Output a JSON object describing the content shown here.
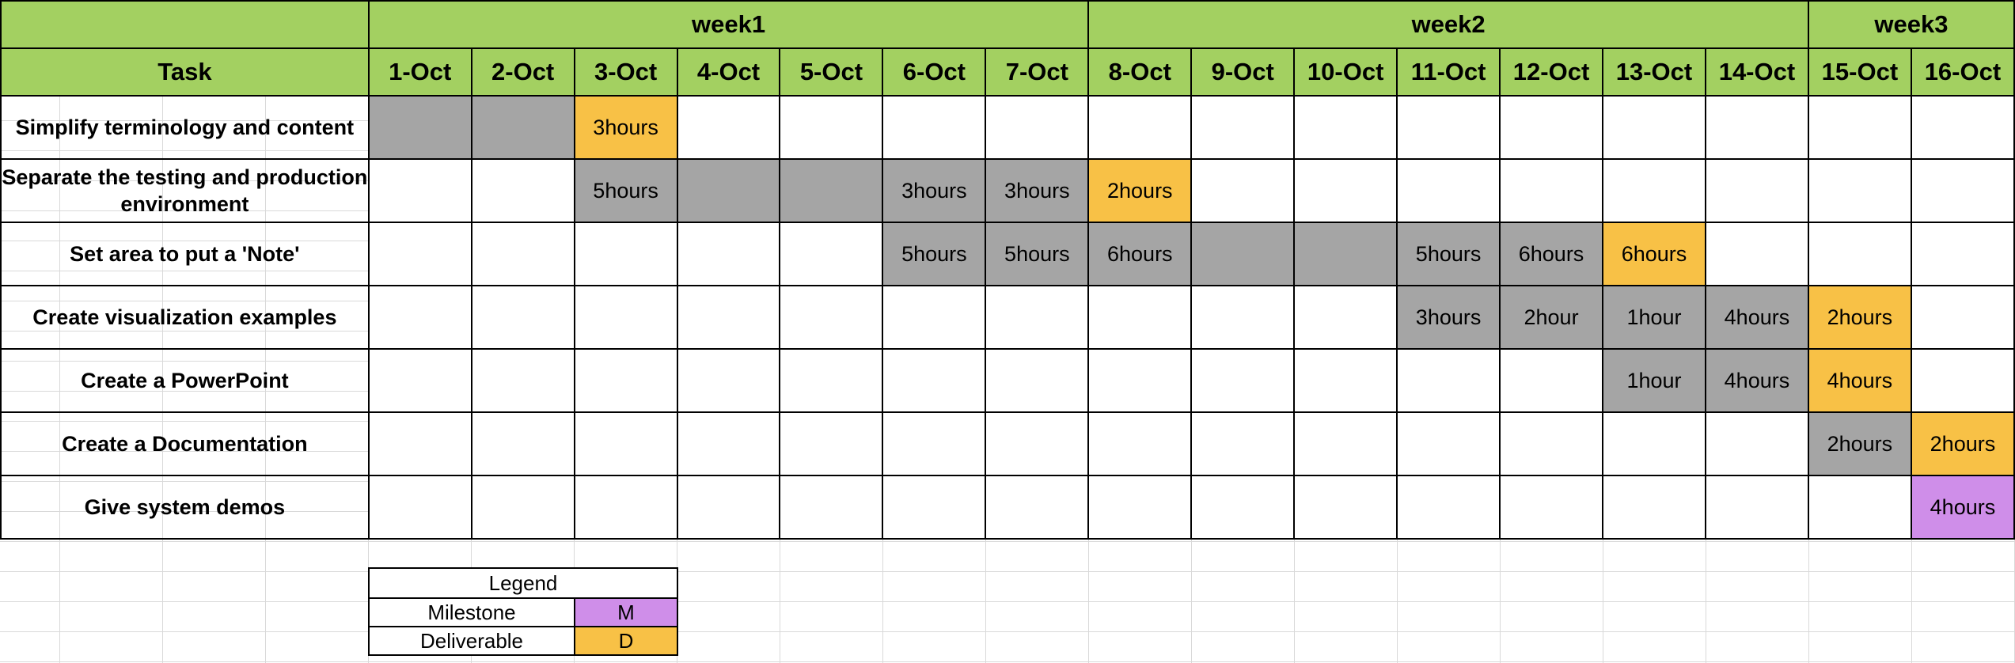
{
  "weeks": [
    {
      "label": "week1",
      "span": 7
    },
    {
      "label": "week2",
      "span": 7
    },
    {
      "label": "week3",
      "span": 2
    }
  ],
  "task_header": "Task",
  "dates": [
    "1-Oct",
    "2-Oct",
    "3-Oct",
    "4-Oct",
    "5-Oct",
    "6-Oct",
    "7-Oct",
    "8-Oct",
    "9-Oct",
    "10-Oct",
    "11-Oct",
    "12-Oct",
    "13-Oct",
    "14-Oct",
    "15-Oct",
    "16-Oct"
  ],
  "tasks": [
    {
      "name": "Simplify terminology and content",
      "cells": [
        {
          "c": "gray",
          "t": ""
        },
        {
          "c": "gray",
          "t": ""
        },
        {
          "c": "yellow",
          "t": "3hours"
        },
        {
          "c": "white",
          "t": ""
        },
        {
          "c": "white",
          "t": ""
        },
        {
          "c": "white",
          "t": ""
        },
        {
          "c": "white",
          "t": ""
        },
        {
          "c": "white",
          "t": ""
        },
        {
          "c": "white",
          "t": ""
        },
        {
          "c": "white",
          "t": ""
        },
        {
          "c": "white",
          "t": ""
        },
        {
          "c": "white",
          "t": ""
        },
        {
          "c": "white",
          "t": ""
        },
        {
          "c": "white",
          "t": ""
        },
        {
          "c": "white",
          "t": ""
        },
        {
          "c": "white",
          "t": ""
        }
      ]
    },
    {
      "name": "Separate the testing and production environment",
      "cells": [
        {
          "c": "white",
          "t": ""
        },
        {
          "c": "white",
          "t": ""
        },
        {
          "c": "gray",
          "t": "5hours"
        },
        {
          "c": "gray",
          "t": ""
        },
        {
          "c": "gray",
          "t": ""
        },
        {
          "c": "gray",
          "t": "3hours"
        },
        {
          "c": "gray",
          "t": "3hours"
        },
        {
          "c": "yellow",
          "t": "2hours"
        },
        {
          "c": "white",
          "t": ""
        },
        {
          "c": "white",
          "t": ""
        },
        {
          "c": "white",
          "t": ""
        },
        {
          "c": "white",
          "t": ""
        },
        {
          "c": "white",
          "t": ""
        },
        {
          "c": "white",
          "t": ""
        },
        {
          "c": "white",
          "t": ""
        },
        {
          "c": "white",
          "t": ""
        }
      ]
    },
    {
      "name": "Set area to put a 'Note'",
      "cells": [
        {
          "c": "white",
          "t": ""
        },
        {
          "c": "white",
          "t": ""
        },
        {
          "c": "white",
          "t": ""
        },
        {
          "c": "white",
          "t": ""
        },
        {
          "c": "white",
          "t": ""
        },
        {
          "c": "gray",
          "t": "5hours"
        },
        {
          "c": "gray",
          "t": "5hours"
        },
        {
          "c": "gray",
          "t": "6hours"
        },
        {
          "c": "gray",
          "t": ""
        },
        {
          "c": "gray",
          "t": ""
        },
        {
          "c": "gray",
          "t": "5hours"
        },
        {
          "c": "gray",
          "t": "6hours"
        },
        {
          "c": "yellow",
          "t": "6hours"
        },
        {
          "c": "white",
          "t": ""
        },
        {
          "c": "white",
          "t": ""
        },
        {
          "c": "white",
          "t": ""
        }
      ]
    },
    {
      "name": "Create visualization examples",
      "cells": [
        {
          "c": "white",
          "t": ""
        },
        {
          "c": "white",
          "t": ""
        },
        {
          "c": "white",
          "t": ""
        },
        {
          "c": "white",
          "t": ""
        },
        {
          "c": "white",
          "t": ""
        },
        {
          "c": "white",
          "t": ""
        },
        {
          "c": "white",
          "t": ""
        },
        {
          "c": "white",
          "t": ""
        },
        {
          "c": "white",
          "t": ""
        },
        {
          "c": "white",
          "t": ""
        },
        {
          "c": "gray",
          "t": "3hours"
        },
        {
          "c": "gray",
          "t": "2hour"
        },
        {
          "c": "gray",
          "t": "1hour"
        },
        {
          "c": "gray",
          "t": "4hours"
        },
        {
          "c": "yellow",
          "t": "2hours"
        },
        {
          "c": "white",
          "t": ""
        }
      ]
    },
    {
      "name": "Create a PowerPoint",
      "cells": [
        {
          "c": "white",
          "t": ""
        },
        {
          "c": "white",
          "t": ""
        },
        {
          "c": "white",
          "t": ""
        },
        {
          "c": "white",
          "t": ""
        },
        {
          "c": "white",
          "t": ""
        },
        {
          "c": "white",
          "t": ""
        },
        {
          "c": "white",
          "t": ""
        },
        {
          "c": "white",
          "t": ""
        },
        {
          "c": "white",
          "t": ""
        },
        {
          "c": "white",
          "t": ""
        },
        {
          "c": "white",
          "t": ""
        },
        {
          "c": "white",
          "t": ""
        },
        {
          "c": "gray",
          "t": "1hour"
        },
        {
          "c": "gray",
          "t": "4hours"
        },
        {
          "c": "yellow",
          "t": "4hours"
        },
        {
          "c": "white",
          "t": ""
        }
      ]
    },
    {
      "name": "Create a Documentation",
      "cells": [
        {
          "c": "white",
          "t": ""
        },
        {
          "c": "white",
          "t": ""
        },
        {
          "c": "white",
          "t": ""
        },
        {
          "c": "white",
          "t": ""
        },
        {
          "c": "white",
          "t": ""
        },
        {
          "c": "white",
          "t": ""
        },
        {
          "c": "white",
          "t": ""
        },
        {
          "c": "white",
          "t": ""
        },
        {
          "c": "white",
          "t": ""
        },
        {
          "c": "white",
          "t": ""
        },
        {
          "c": "white",
          "t": ""
        },
        {
          "c": "white",
          "t": ""
        },
        {
          "c": "white",
          "t": ""
        },
        {
          "c": "white",
          "t": ""
        },
        {
          "c": "gray",
          "t": "2hours"
        },
        {
          "c": "yellow",
          "t": "2hours"
        }
      ]
    },
    {
      "name": "Give system demos",
      "cells": [
        {
          "c": "white",
          "t": ""
        },
        {
          "c": "white",
          "t": ""
        },
        {
          "c": "white",
          "t": ""
        },
        {
          "c": "white",
          "t": ""
        },
        {
          "c": "white",
          "t": ""
        },
        {
          "c": "white",
          "t": ""
        },
        {
          "c": "white",
          "t": ""
        },
        {
          "c": "white",
          "t": ""
        },
        {
          "c": "white",
          "t": ""
        },
        {
          "c": "white",
          "t": ""
        },
        {
          "c": "white",
          "t": ""
        },
        {
          "c": "white",
          "t": ""
        },
        {
          "c": "white",
          "t": ""
        },
        {
          "c": "white",
          "t": ""
        },
        {
          "c": "white",
          "t": ""
        },
        {
          "c": "purple",
          "t": "4hours"
        }
      ]
    }
  ],
  "legend": {
    "title": "Legend",
    "milestone_label": "Milestone",
    "milestone_code": "M",
    "deliverable_label": "Deliverable",
    "deliverable_code": "D"
  },
  "colors": {
    "header_green": "#a3d061",
    "in_progress_gray": "#a5a5a5",
    "deliverable_yellow": "#f8c146",
    "milestone_purple": "#cf8ee9"
  }
}
